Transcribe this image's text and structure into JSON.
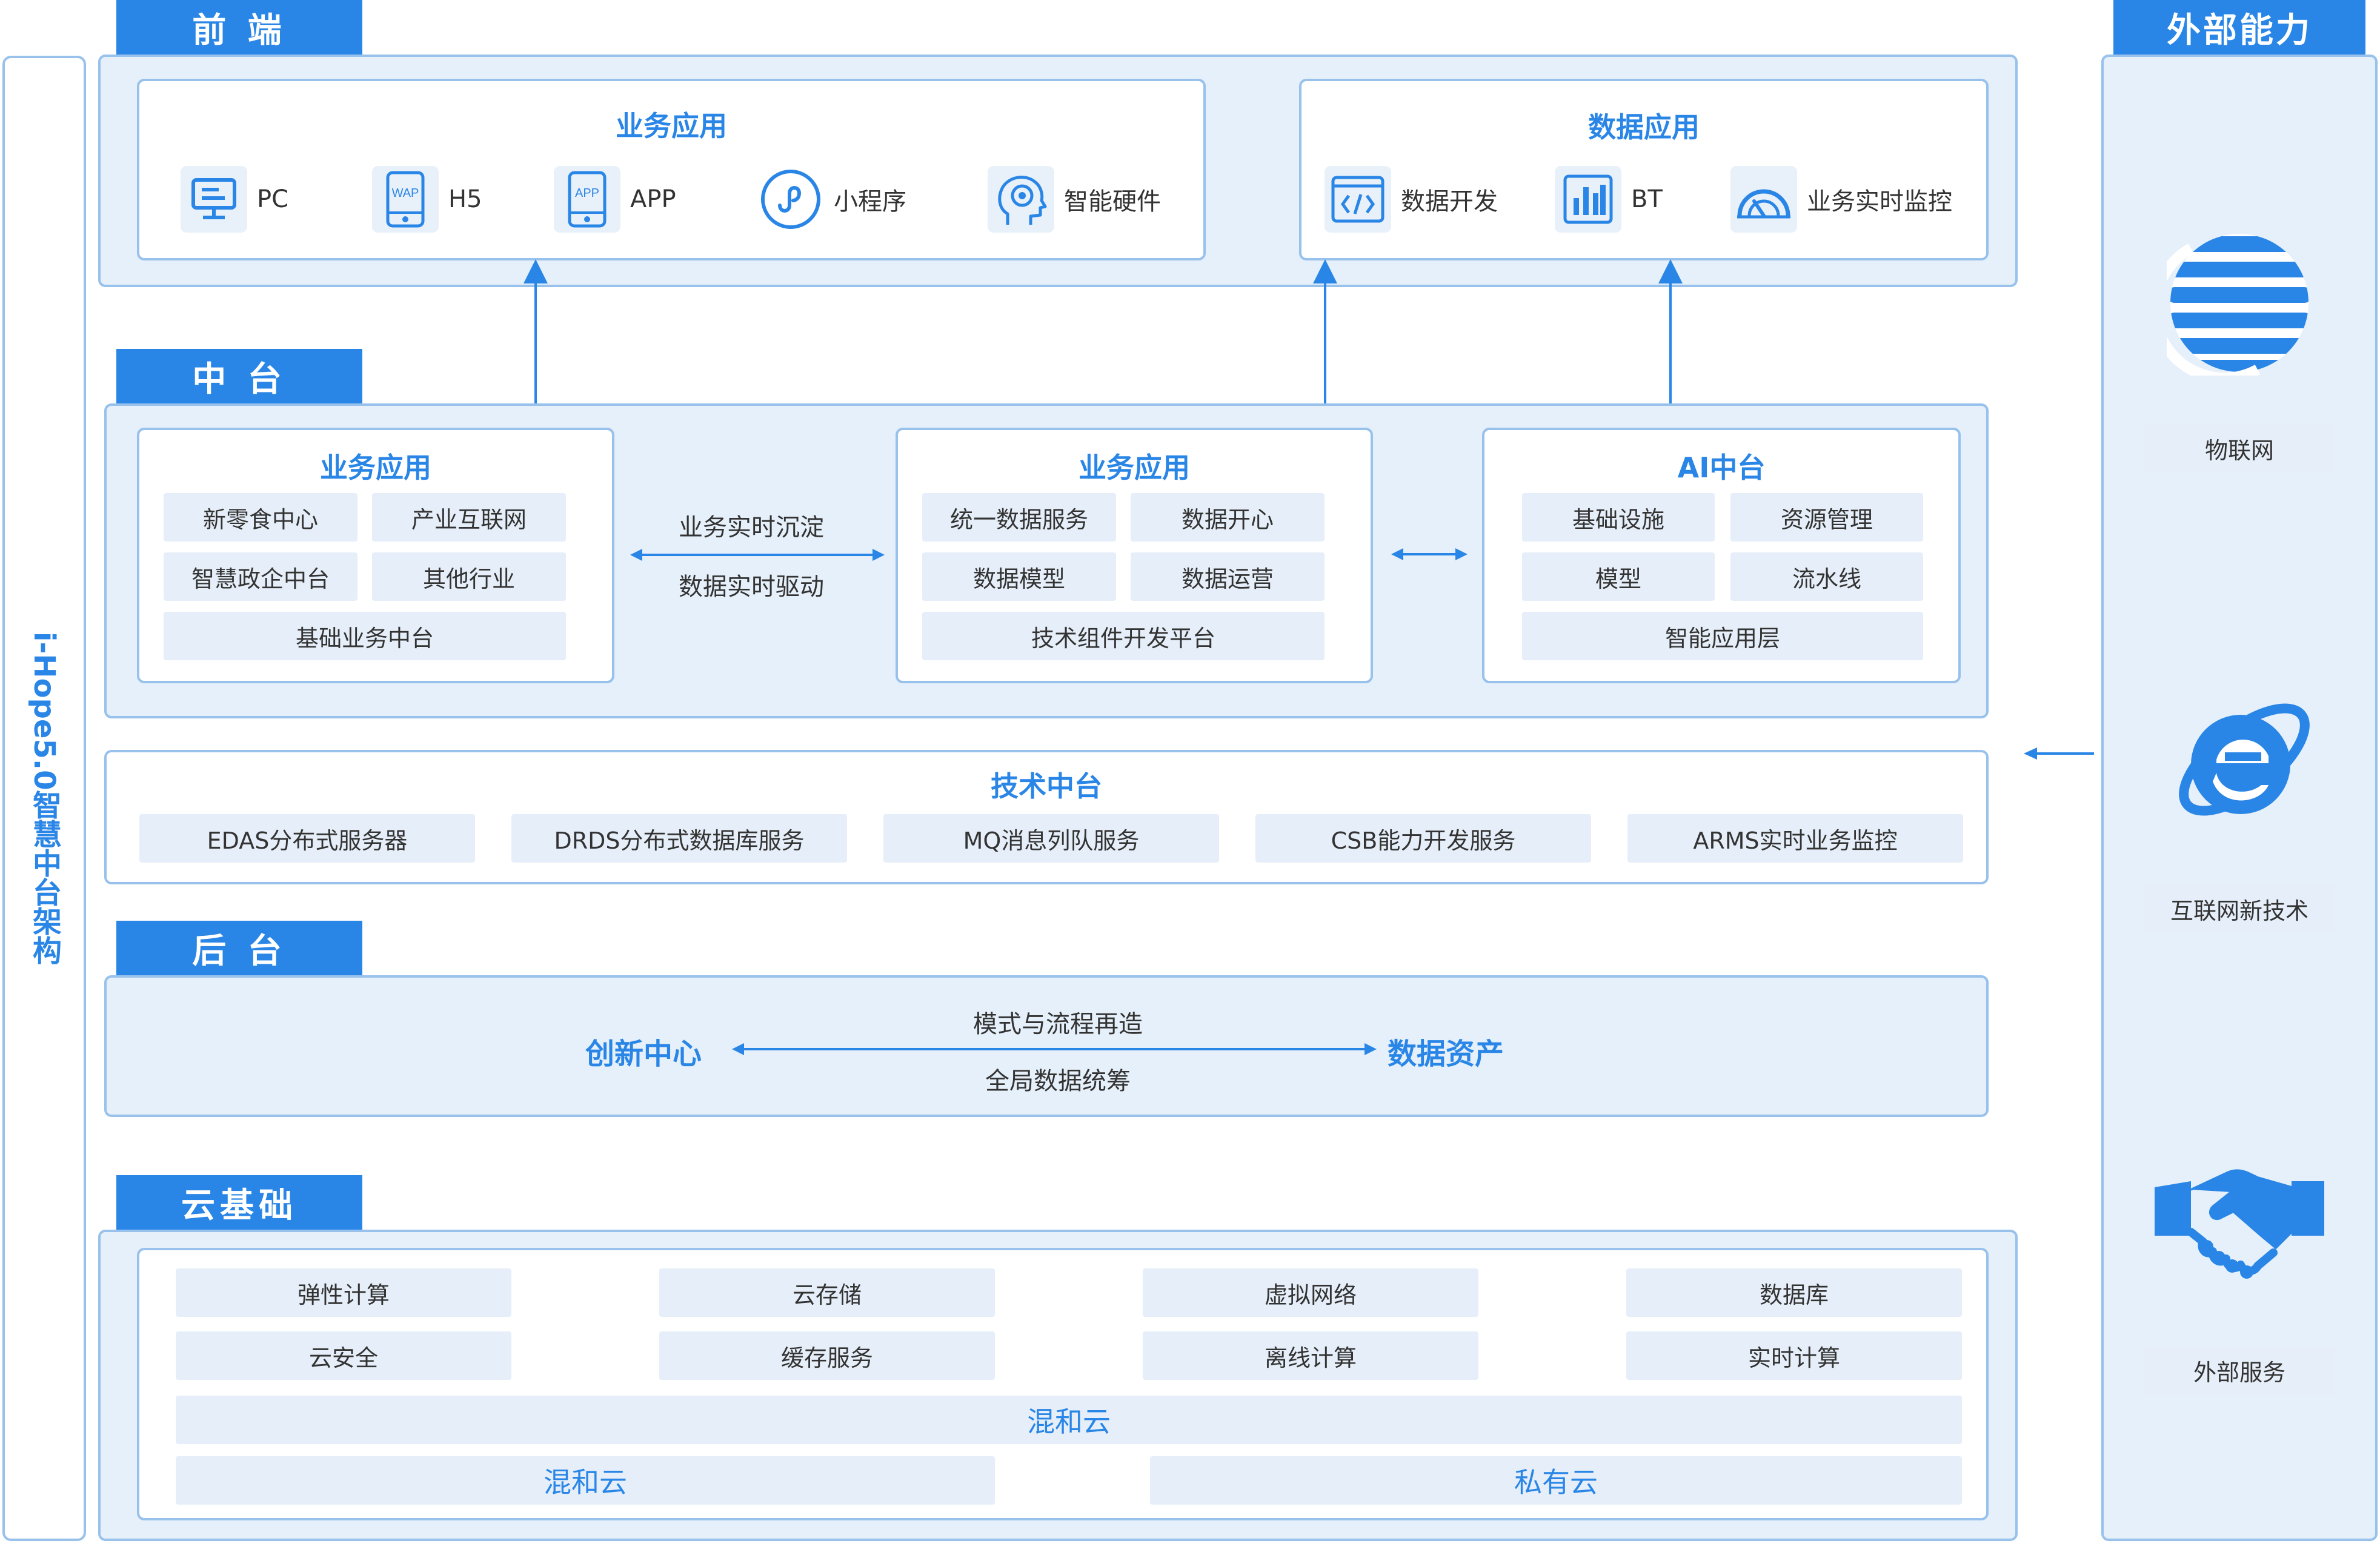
{
  "side_title": "i-Hope5.0智慧中台架构",
  "frontend": {
    "tab": "前 端",
    "business_apps": {
      "title": "业务应用",
      "items": [
        {
          "label": "PC",
          "icon": "monitor-icon"
        },
        {
          "label": "H5",
          "icon": "wap-phone-icon",
          "badge": "WAP"
        },
        {
          "label": "APP",
          "icon": "app-phone-icon",
          "badge": "APP"
        },
        {
          "label": "小程序",
          "icon": "mini-program-icon"
        },
        {
          "label": "智能硬件",
          "icon": "brain-gear-icon"
        }
      ]
    },
    "data_apps": {
      "title": "数据应用",
      "items": [
        {
          "label": "数据开发",
          "icon": "code-icon"
        },
        {
          "label": "BT",
          "icon": "bar-chart-icon"
        },
        {
          "label": "业务实时监控",
          "icon": "gauge-icon"
        }
      ]
    }
  },
  "middle": {
    "tab": "中 台",
    "business_center": {
      "title": "业务应用",
      "chips": [
        "新零食中心",
        "产业互联网",
        "智慧政企中台",
        "其他行业",
        "基础业务中台"
      ]
    },
    "sync_labels": [
      "业务实时沉淀",
      "数据实时驱动"
    ],
    "data_center": {
      "title": "业务应用",
      "chips": [
        "统一数据服务",
        "数据开心",
        "数据模型",
        "数据运营",
        "技术组件开发平台"
      ]
    },
    "ai_center": {
      "title": "AI中台",
      "chips": [
        "基础设施",
        "资源管理",
        "模型",
        "流水线",
        "智能应用层"
      ]
    },
    "tech_center": {
      "title": "技术中台",
      "chips": [
        "EDAS分布式服务器",
        "DRDS分布式数据库服务",
        "MQ消息列队服务",
        "CSB能力开发服务",
        "ARMS实时业务监控"
      ]
    }
  },
  "backend": {
    "tab": "后 台",
    "left": "创新中心",
    "right": "数据资产",
    "top_label": "模式与流程再造",
    "bottom_label": "全局数据统筹"
  },
  "cloud": {
    "tab": "云基础",
    "row1": [
      "弹性计算",
      "云存储",
      "虚拟网络",
      "数据库"
    ],
    "row2": [
      "云安全",
      "缓存服务",
      "离线计算",
      "实时计算"
    ],
    "hybrid_full": "混和云",
    "hybrid_half": "混和云",
    "private": "私有云"
  },
  "external": {
    "tab": "外部能力",
    "items": [
      {
        "label": "物联网",
        "icon": "globe-icon"
      },
      {
        "label": "互联网新技术",
        "icon": "ie-icon"
      },
      {
        "label": "外部服务",
        "icon": "handshake-icon"
      }
    ]
  },
  "colors": {
    "accent": "#2a86e6",
    "panel": "#e6f0fa",
    "border": "#98c2ec",
    "chip": "#e6eff9"
  }
}
